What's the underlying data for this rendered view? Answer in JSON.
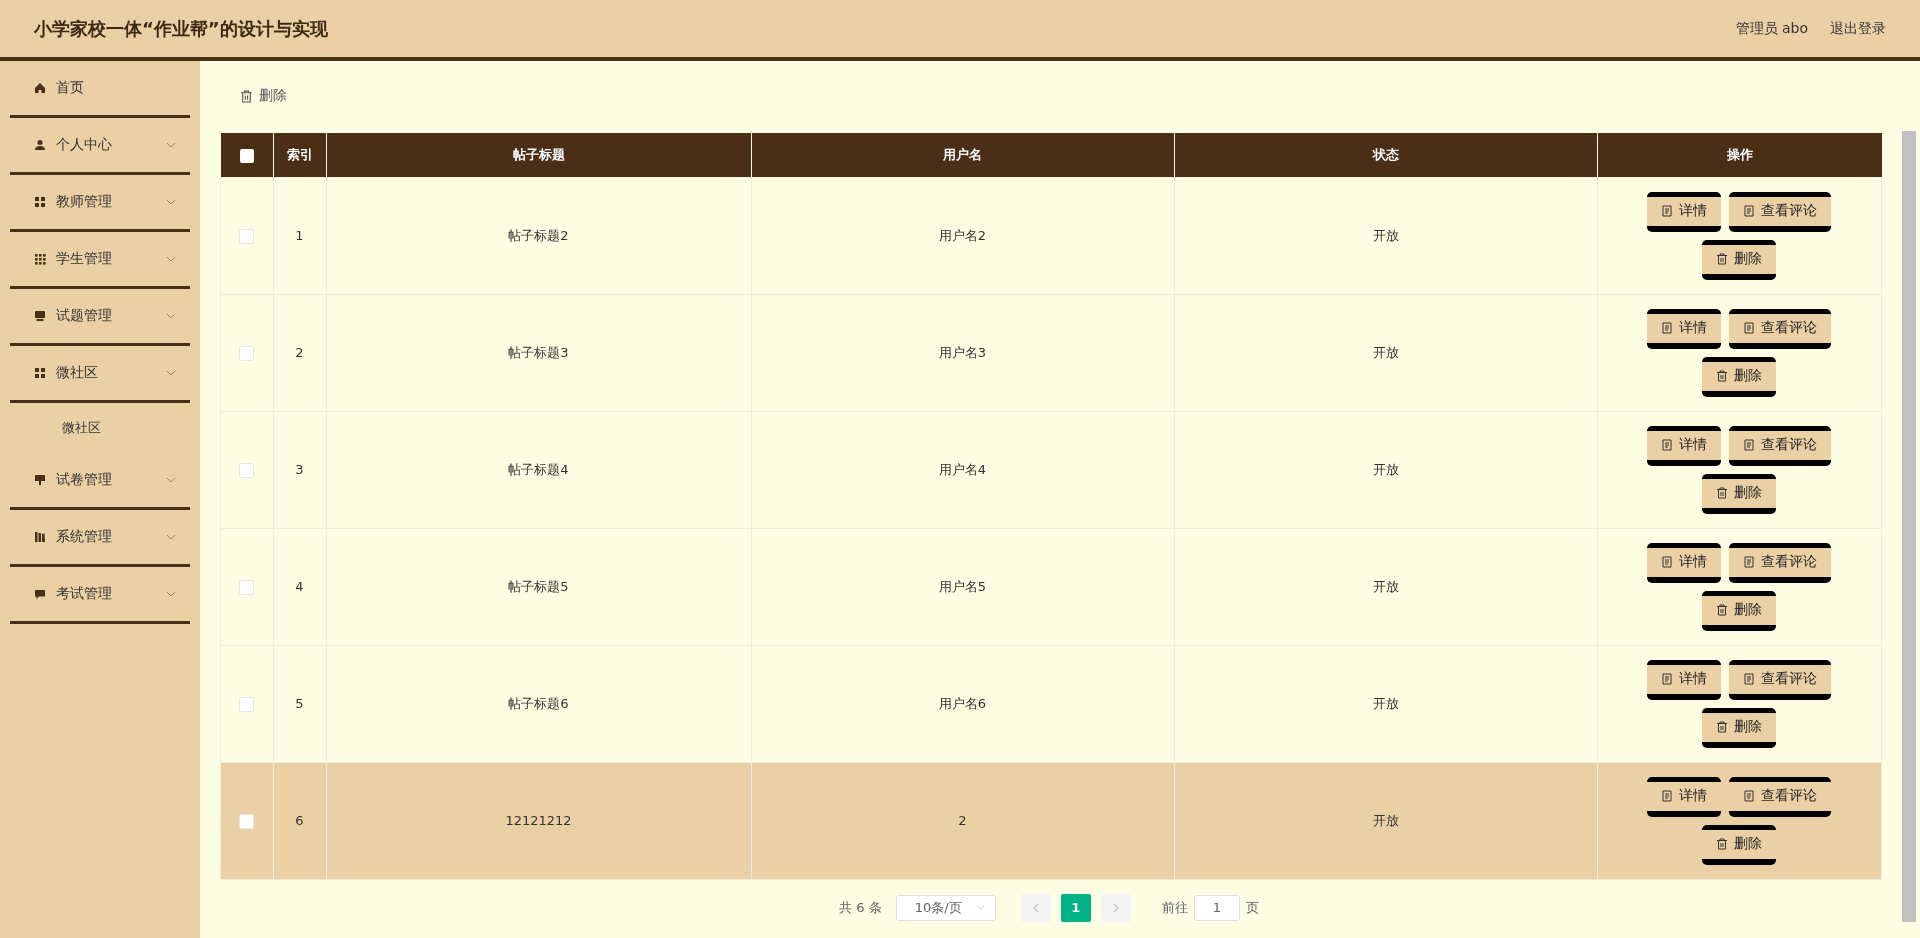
{
  "header": {
    "title": "小学家校一体“作业帮”的设计与实现",
    "user": "管理员 abo",
    "logout": "退出登录"
  },
  "sidebar": {
    "items": [
      {
        "label": "首页"
      },
      {
        "label": "个人中心"
      },
      {
        "label": "教师管理"
      },
      {
        "label": "学生管理"
      },
      {
        "label": "试题管理"
      },
      {
        "label": "微社区",
        "children": [
          {
            "label": "微社区"
          }
        ]
      },
      {
        "label": "试卷管理"
      },
      {
        "label": "系统管理"
      },
      {
        "label": "考试管理"
      }
    ]
  },
  "toolbar": {
    "delete": "删除"
  },
  "table": {
    "select_all_checked": false,
    "columns": [
      "索引",
      "帖子标题",
      "用户名",
      "状态",
      "操作"
    ],
    "rows": [
      {
        "index": "1",
        "title": "帖子标题2",
        "username": "用户名2",
        "status": "开放",
        "checked": false,
        "highlighted": false,
        "actions": [
          "详情",
          "查看评论",
          "删除"
        ]
      },
      {
        "index": "2",
        "title": "帖子标题3",
        "username": "用户名3",
        "status": "开放",
        "checked": false,
        "highlighted": false,
        "actions": [
          "详情",
          "查看评论",
          "删除"
        ]
      },
      {
        "index": "3",
        "title": "帖子标题4",
        "username": "用户名4",
        "status": "开放",
        "checked": false,
        "highlighted": false,
        "actions": [
          "详情",
          "查看评论",
          "删除"
        ]
      },
      {
        "index": "4",
        "title": "帖子标题5",
        "username": "用户名5",
        "status": "开放",
        "checked": false,
        "highlighted": false,
        "actions": [
          "详情",
          "查看评论",
          "删除"
        ]
      },
      {
        "index": "5",
        "title": "帖子标题6",
        "username": "用户名6",
        "status": "开放",
        "checked": false,
        "highlighted": false,
        "actions": [
          "详情",
          "查看评论",
          "删除"
        ]
      },
      {
        "index": "6",
        "title": "12121212",
        "username": "2",
        "status": "开放",
        "checked": false,
        "highlighted": true,
        "actions": [
          "详情",
          "查看评论",
          "删除"
        ]
      }
    ]
  },
  "pagination": {
    "total": "共 6 条",
    "page_size": "10条/页",
    "pages": [
      {
        "label": "1",
        "selected": true
      }
    ],
    "goto_label": "前往",
    "goto_value": "1",
    "page_suffix": "页"
  }
}
